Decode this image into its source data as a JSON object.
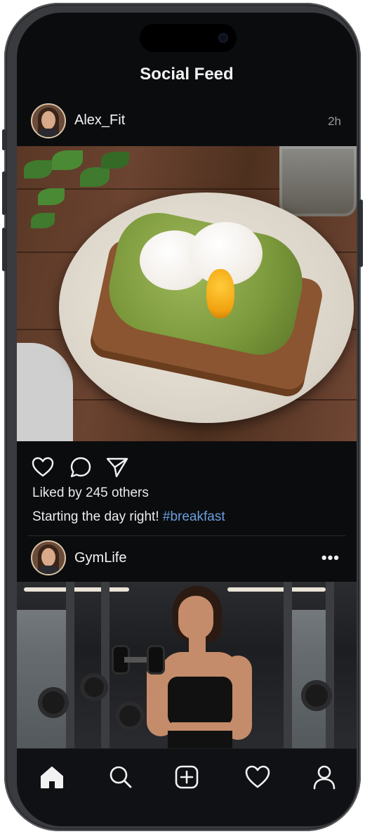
{
  "app": {
    "title": "Social Feed"
  },
  "posts": [
    {
      "username": "Alex_Fit",
      "time": "2h",
      "image": "avocado-toast-with-poached-eggs",
      "likes_text": "Liked by 245 others",
      "caption_text": "Starting the day right!",
      "caption_tag": "#breakfast"
    },
    {
      "username": "GymLife",
      "image": "woman-lifting-dumbbell-in-gym",
      "more": "•••"
    }
  ],
  "actions": [
    "heart-icon",
    "comment-icon",
    "share-icon"
  ],
  "tabbar": [
    "home-icon",
    "search-icon",
    "create-post-icon",
    "activity-heart-icon",
    "profile-icon"
  ],
  "colors": {
    "background": "#0b0c0e",
    "hashtag": "#6b9fe0",
    "text": "#f2f2f2",
    "muted": "#9a9a9a"
  }
}
